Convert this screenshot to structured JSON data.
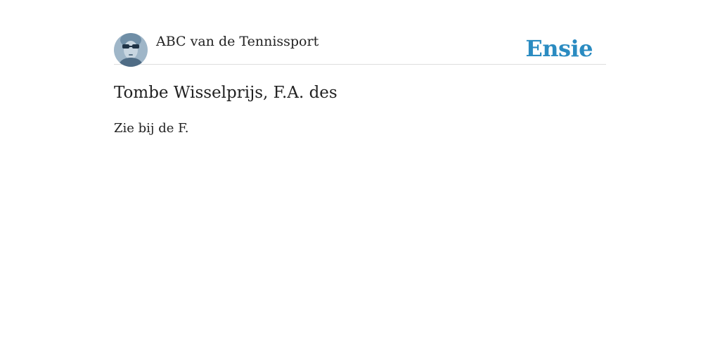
{
  "header": {
    "site_title": "ABC van de Tennissport",
    "brand": "Ensie",
    "avatar_icon": "portrait-photo-icon"
  },
  "entry": {
    "title": "Tombe Wisselprijs, F.A. des",
    "body": "Zie bij de F."
  },
  "colors": {
    "brand": "#2a8bc1",
    "text": "#222222",
    "divider": "#dddddd"
  }
}
